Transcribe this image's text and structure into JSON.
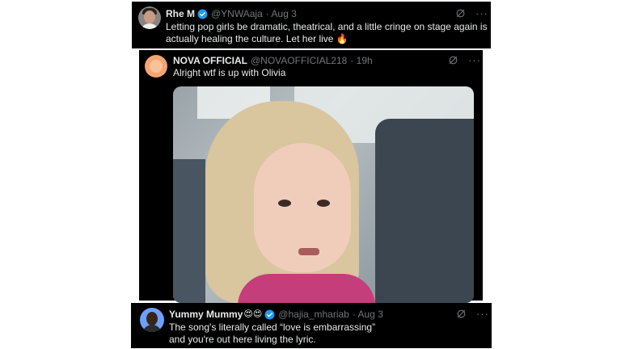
{
  "tweets": [
    {
      "name": "Rhe M",
      "handle": "@YNWAaja",
      "date": "· Aug 3",
      "text_line1": "Letting pop girls be dramatic, theatrical, and a little cringe on stage again is",
      "text_line2": "actually healing the culture. Let her live 🔥",
      "verified": true,
      "icons": [
        "avatar",
        "verified-icon",
        "grok-icon",
        "more-icon"
      ]
    },
    {
      "name": "NOVA OFFICIAL",
      "handle": "@NOVAOFFICIAL218",
      "date": "· 19h",
      "text": "Alright wtf is up with Olivia",
      "media": "gif of a toddler in a car seat looking sideways",
      "verified": false
    },
    {
      "name": "Yummy Mummy",
      "name_emoji": "😍😍",
      "handle": "@hajia_mhariab",
      "date": "· Aug 3",
      "text_line1": "The song's literally called “love is embarrassing”",
      "text_line2": "and you're out here living the lyric.",
      "verified": true
    }
  ],
  "colors": {
    "card_background": "#000000",
    "text": "#e7e9ea",
    "muted": "#71767b",
    "verified": "#1d9bf0",
    "page_background": "#ffffff"
  },
  "more_glyph": "···"
}
